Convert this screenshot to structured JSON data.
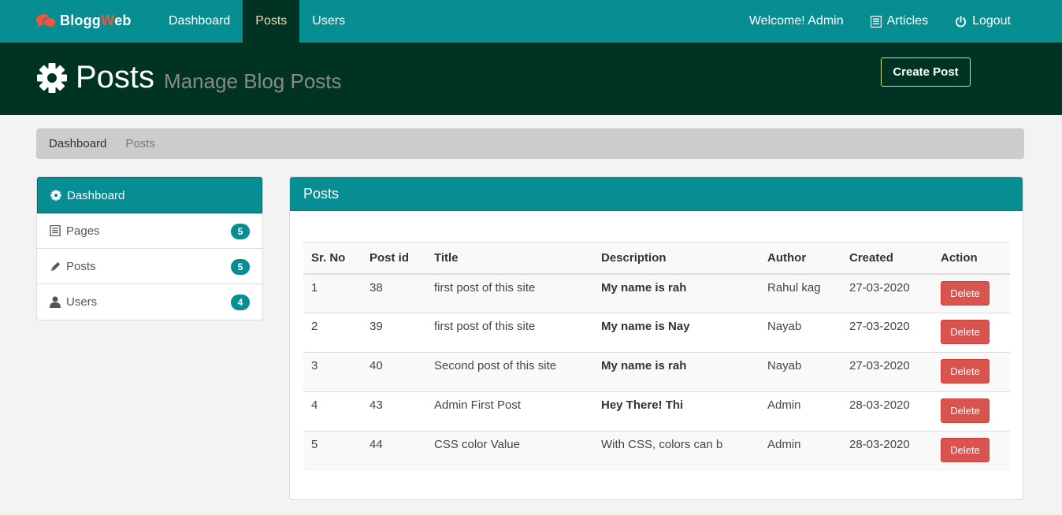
{
  "brand": {
    "part1": "Blogg",
    "part2": "W",
    "part3": "eb",
    "accent_color": "#f0563a"
  },
  "nav": {
    "left": [
      {
        "label": "Dashboard",
        "active": false
      },
      {
        "label": "Posts",
        "active": true
      },
      {
        "label": "Users",
        "active": false
      }
    ],
    "welcome": "Welcome! Admin",
    "articles": "Articles",
    "logout": "Logout"
  },
  "header": {
    "title": "Posts",
    "subtitle": "Manage Blog Posts",
    "create_button": "Create Post"
  },
  "breadcrumb": {
    "home": "Dashboard",
    "current": "Posts"
  },
  "sidebar": {
    "items": [
      {
        "label": "Dashboard",
        "icon": "gear-icon"
      },
      {
        "label": "Pages",
        "icon": "list-icon",
        "count": "5"
      },
      {
        "label": "Posts",
        "icon": "pencil-icon",
        "count": "5"
      },
      {
        "label": "Users",
        "icon": "user-icon",
        "count": "4"
      }
    ]
  },
  "panel": {
    "title": "Posts",
    "columns": [
      "Sr. No",
      "Post id",
      "Title",
      "Description",
      "Author",
      "Created",
      "Action"
    ],
    "rows": [
      {
        "sr": "1",
        "post_id": "38",
        "title": "first post of this site",
        "description": "My name is rah",
        "author": "Rahul kag",
        "created": "27-03-2020",
        "action": "Delete"
      },
      {
        "sr": "2",
        "post_id": "39",
        "title": "first post of this site",
        "description": "My name is Nay",
        "author": "Nayab",
        "created": "27-03-2020",
        "action": "Delete"
      },
      {
        "sr": "3",
        "post_id": "40",
        "title": "Second post of this site",
        "description": "My name is rah",
        "author": "Nayab",
        "created": "27-03-2020",
        "action": "Delete"
      },
      {
        "sr": "4",
        "post_id": "43",
        "title": "Admin First Post",
        "description": "Hey There! Thi",
        "author": "Admin",
        "created": "28-03-2020",
        "action": "Delete"
      },
      {
        "sr": "5",
        "post_id": "44",
        "title": "CSS color Value",
        "description": "With CSS, colors can b",
        "author": "Admin",
        "created": "28-03-2020",
        "action": "Delete"
      }
    ]
  },
  "colors": {
    "navbar": "#068e92",
    "header": "#003323",
    "danger": "#d9534f"
  }
}
